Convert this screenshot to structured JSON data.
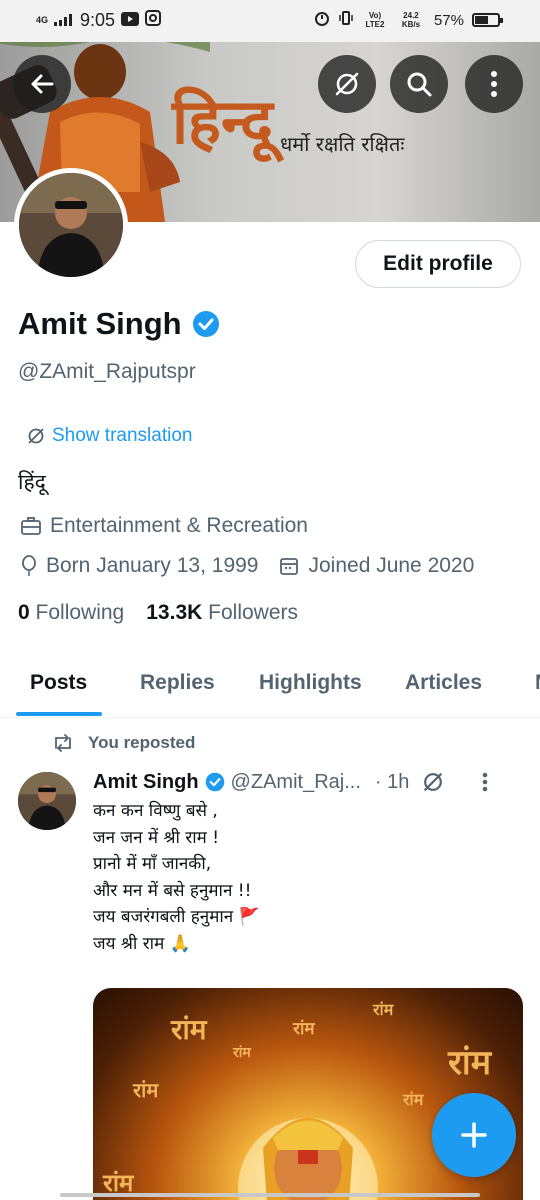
{
  "status_bar": {
    "network": "4G",
    "time": "9:05",
    "lte": "Vo) LTE2",
    "speed": "24.2 KB/s",
    "battery": "57%",
    "battery_level": 0.57
  },
  "banner": {
    "title": "हिन्दू",
    "subtitle": "धर्मो रक्षति रक्षितः"
  },
  "profile": {
    "edit_label": "Edit profile",
    "name": "Amit Singh",
    "handle": "@ZAmit_Rajputspr",
    "translate_label": "Show translation",
    "bio": "हिंदू",
    "category": "Entertainment & Recreation",
    "born": "Born January 13, 1999",
    "joined": "Joined June 2020",
    "following_count": "0",
    "following_label": "Following",
    "followers_count": "13.3K",
    "followers_label": "Followers"
  },
  "tabs": [
    "Posts",
    "Replies",
    "Highlights",
    "Articles",
    "M"
  ],
  "post": {
    "repost_label": "You reposted",
    "author": "Amit Singh",
    "handle": "@ZAmit_Raj...",
    "time": "· 1h",
    "lines": [
      "कन कन विष्णु बसे ,",
      "जन जन में श्री राम !",
      "प्रानो में माँ जानकी,",
      "और मन में बसे हनुमान !!",
      "जय बजरंगबली हनुमान 🚩",
      "जय श्री राम 🙏"
    ],
    "image_text": "रांम"
  },
  "colors": {
    "accent": "#1d9bf0",
    "text": "#0f1419",
    "secondary": "#536471"
  }
}
